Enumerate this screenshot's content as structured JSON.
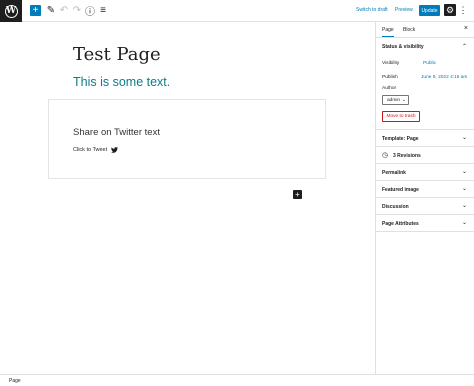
{
  "toolbar": {
    "wp_logo": "W",
    "add_icon": "+",
    "edit_icon": "✎",
    "undo_icon": "↶",
    "redo_icon": "↷",
    "info_icon": "ⓘ",
    "list_icon": "≡",
    "switch_to_draft": "Switch to draft",
    "preview": "Preview",
    "update": "Update",
    "settings_icon": "⚙",
    "more_icon": "⋮"
  },
  "editor": {
    "title": "Test Page",
    "paragraph": "This is some text.",
    "share_block": {
      "title": "Share on Twitter text",
      "tweet_label": "Click to Tweet"
    },
    "block_adder": "+"
  },
  "sidebar": {
    "tabs": [
      "Page",
      "Block"
    ],
    "close_icon": "×",
    "status": {
      "title": "Status & visibility",
      "visibility_label": "Visibility",
      "visibility_value": "Public",
      "publish_label": "Publish",
      "publish_value": "June 9, 2022 4:15 am",
      "author_label": "Author",
      "author_value": "admin",
      "trash_label": "Move to trash"
    },
    "panels": {
      "template": "Template: Page",
      "revisions": "3 Revisions",
      "permalink": "Permalink",
      "featured_image": "Featured image",
      "discussion": "Discussion",
      "page_attributes": "Page Attributes"
    }
  },
  "footer": {
    "breadcrumb": "Page"
  },
  "colors": {
    "accent": "#007cba",
    "paragraph_text": "#0f7a8a",
    "danger": "#cc1818",
    "dark": "#1e1e1e"
  }
}
